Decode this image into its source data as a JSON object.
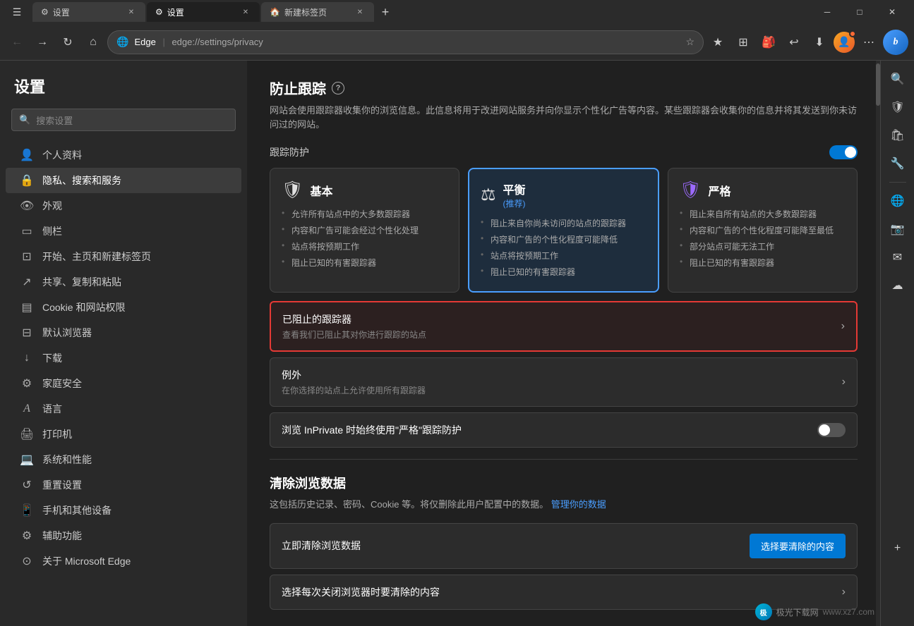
{
  "browser": {
    "tabs": [
      {
        "id": "tab1",
        "icon": "⚙",
        "title": "设置",
        "active": false
      },
      {
        "id": "tab2",
        "icon": "⚙",
        "title": "设置",
        "active": true
      },
      {
        "id": "tab3",
        "icon": "🏠",
        "title": "新建标签页",
        "active": false
      }
    ],
    "new_tab_label": "+",
    "address": {
      "brand": "Edge",
      "url": "edge://settings/privacy",
      "display_brand": "Edge",
      "display_sep": "|",
      "display_path": "edge://settings/privacy"
    },
    "window_controls": {
      "minimize": "─",
      "maximize": "□",
      "close": "✕"
    }
  },
  "toolbar": {
    "back_icon": "←",
    "forward_icon": "→",
    "refresh_icon": "↻",
    "home_icon": "⌂",
    "favorites_icon": "☆",
    "collections_icon": "⊞",
    "settings_icon": "⋯"
  },
  "sidebar": {
    "title": "设置",
    "search_placeholder": "搜索设置",
    "items": [
      {
        "id": "profile",
        "icon": "👤",
        "label": "个人资料"
      },
      {
        "id": "privacy",
        "icon": "🔒",
        "label": "隐私、搜索和服务",
        "active": true
      },
      {
        "id": "appearance",
        "icon": "👁",
        "label": "外观"
      },
      {
        "id": "sidebar",
        "icon": "▭",
        "label": "侧栏"
      },
      {
        "id": "newtab",
        "icon": "⊡",
        "label": "开始、主页和新建标签页"
      },
      {
        "id": "sharing",
        "icon": "↗",
        "label": "共享、复制和粘贴"
      },
      {
        "id": "cookies",
        "icon": "▤",
        "label": "Cookie 和网站权限"
      },
      {
        "id": "browser",
        "icon": "⊟",
        "label": "默认浏览器"
      },
      {
        "id": "downloads",
        "icon": "↓",
        "label": "下载"
      },
      {
        "id": "family",
        "icon": "⚙",
        "label": "家庭安全"
      },
      {
        "id": "language",
        "icon": "A",
        "label": "语言"
      },
      {
        "id": "printer",
        "icon": "🖨",
        "label": "打印机"
      },
      {
        "id": "system",
        "icon": "💻",
        "label": "系统和性能"
      },
      {
        "id": "reset",
        "icon": "↺",
        "label": "重置设置"
      },
      {
        "id": "mobile",
        "icon": "📱",
        "label": "手机和其他设备"
      },
      {
        "id": "accessibility",
        "icon": "⚙",
        "label": "辅助功能"
      },
      {
        "id": "about",
        "icon": "⊙",
        "label": "关于 Microsoft Edge"
      }
    ]
  },
  "content": {
    "section_title": "防止跟踪",
    "section_desc": "网站会使用跟踪器收集你的浏览信息。此信息将用于改进网站服务并向你显示个性化广告等内容。某些跟踪器会收集你的信息并将其发送到你未访问过的网站。",
    "tracking_label": "跟踪防护",
    "cards": [
      {
        "id": "basic",
        "icon": "🛡",
        "title": "基本",
        "subtitle": "",
        "selected": false,
        "items": [
          "允许所有站点中的大多数跟踪器",
          "内容和广告可能会经过个性化处理",
          "站点将按预期工作",
          "阻止已知的有害跟踪器"
        ]
      },
      {
        "id": "balanced",
        "icon": "⚖",
        "title": "平衡",
        "subtitle": "(推荐)",
        "selected": true,
        "items": [
          "阻止来自你尚未访问的站点的跟踪器",
          "内容和广告的个性化程度可能降低",
          "站点将按预期工作",
          "阻止已知的有害跟踪器"
        ]
      },
      {
        "id": "strict",
        "icon": "🛡",
        "title": "严格",
        "subtitle": "",
        "selected": false,
        "items": [
          "阻止来自所有站点的大多数跟踪器",
          "内容和广告的个性化程度可能降至最低",
          "部分站点可能无法工作",
          "阻止已知的有害跟踪器"
        ]
      }
    ],
    "blocked_trackers": {
      "title": "已阻止的跟踪器",
      "desc": "查看我们已阻止其对你进行跟踪的站点",
      "highlighted": true
    },
    "exceptions": {
      "title": "例外",
      "desc": "在你选择的站点上允许使用所有跟踪器"
    },
    "inprivate_label": "浏览 InPrivate 时始终使用\"严格\"跟踪防护",
    "clear_section": {
      "title": "清除浏览数据",
      "desc_start": "这包括历史记录、密码、Cookie 等。将仅删除此用户配置中的数据。",
      "link_text": "管理你的数据",
      "clear_now_label": "立即清除浏览数据",
      "clear_now_btn": "选择要清除的内容",
      "clear_on_close_label": "选择每次关闭浏览器时要清除的内容"
    }
  },
  "right_panel": {
    "icons": [
      "🔍",
      "🛡",
      "🎒",
      "⚙",
      "⊕",
      "✉",
      "♦",
      "⊕"
    ]
  },
  "watermark": {
    "text": "极光下载网",
    "url": "www.xz7.com"
  }
}
